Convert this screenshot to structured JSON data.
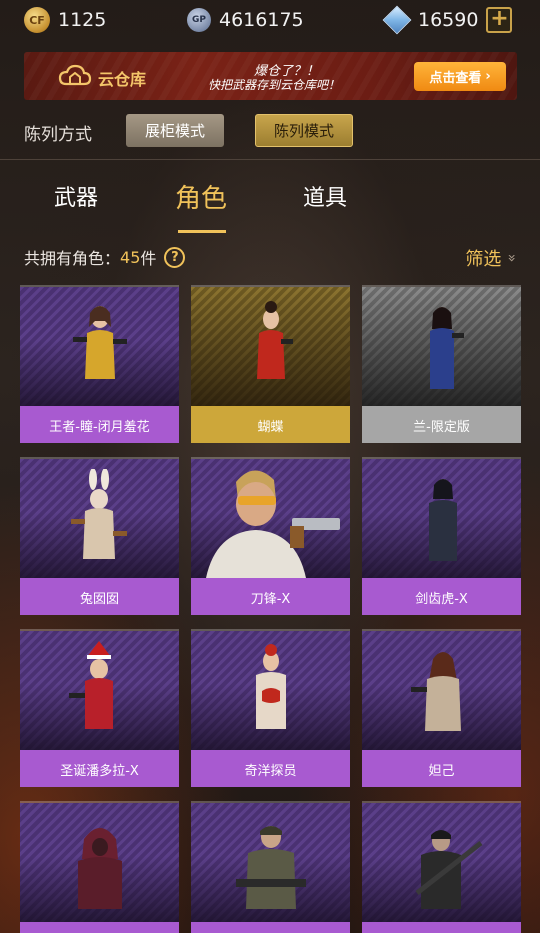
{
  "resources": {
    "coins": "1125",
    "coin_icon_text": "CF",
    "gp": "4616175",
    "gp_icon_text": "GP",
    "diamonds": "16590",
    "plus_label": "+"
  },
  "banner": {
    "title": "云仓库",
    "line1": "爆仓了？！",
    "line2": "快把武器存到云仓库吧！",
    "button_label": "点击查看",
    "button_arrow": "›"
  },
  "arrangement": {
    "label": "陈列方式",
    "options": [
      "展柜模式",
      "陈列模式"
    ],
    "selected": "陈列模式"
  },
  "tabs": [
    {
      "label": "武器",
      "active": false
    },
    {
      "label": "角色",
      "active": true
    },
    {
      "label": "道具",
      "active": false
    }
  ],
  "summary": {
    "prefix": "共拥有角色：",
    "count": "45",
    "unit": "件",
    "help_icon": "?",
    "filter_label": "筛选",
    "filter_icon": "»"
  },
  "characters": [
    {
      "name": "王者-瞳-闭月羞花",
      "rarity": "purple"
    },
    {
      "name": "蝴蝶",
      "rarity": "gold"
    },
    {
      "name": "兰-限定版",
      "rarity": "gray"
    },
    {
      "name": "兔囡囡",
      "rarity": "purple"
    },
    {
      "name": "刀锋-X",
      "rarity": "purple"
    },
    {
      "name": "剑齿虎-X",
      "rarity": "purple"
    },
    {
      "name": "圣诞潘多拉-X",
      "rarity": "purple"
    },
    {
      "name": "奇洋探员",
      "rarity": "purple"
    },
    {
      "name": "妲己",
      "rarity": "purple"
    },
    {
      "name": "",
      "rarity": "purple"
    },
    {
      "name": "",
      "rarity": "purple"
    },
    {
      "name": "",
      "rarity": "purple"
    }
  ],
  "colors": {
    "accent_gold": "#f0c25a",
    "rarity_purple": "#a85ad0",
    "rarity_gold": "#cda73a",
    "rarity_gray": "#a6a6a6",
    "banner_button": "#f08a12"
  }
}
